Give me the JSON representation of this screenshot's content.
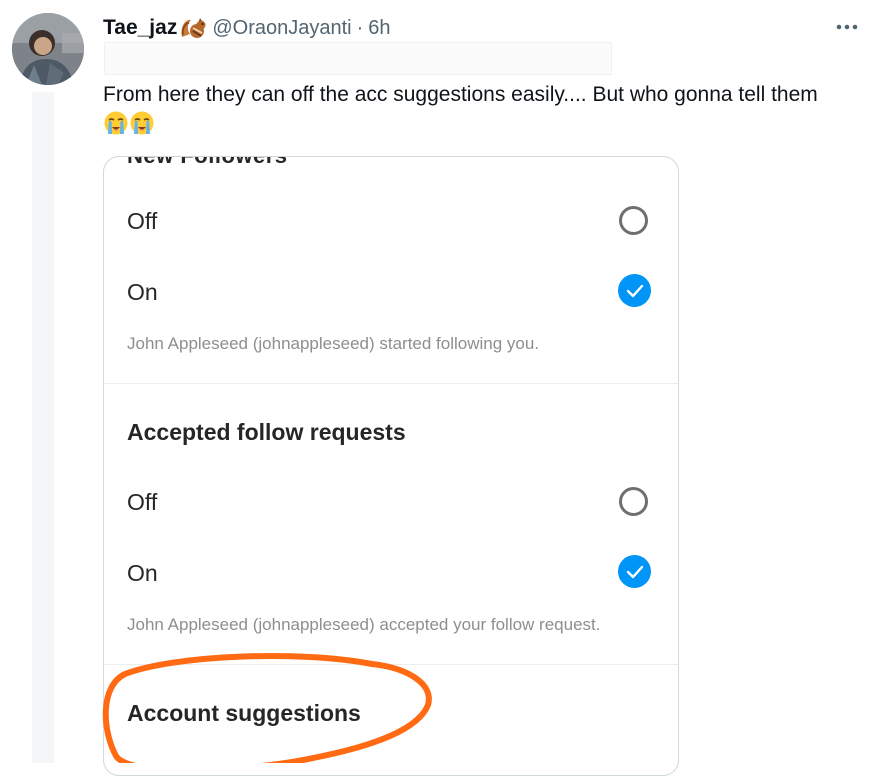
{
  "tweet": {
    "author": {
      "display_name": "Tae_jaz",
      "name_emoji": "chipmunk-emoji",
      "handle": "@OraonJayanti",
      "separator": "·",
      "time": "6h"
    },
    "more_icon": "more-horizontal-icon",
    "text": "From here they can off the acc suggestions easily.... But who gonna tell them",
    "text_emojis": [
      "loudly-crying-face-emoji",
      "loudly-crying-face-emoji"
    ]
  },
  "screenshot": {
    "cut_heading": "New Followers",
    "new_followers": {
      "options": [
        {
          "label": "Off",
          "selected": false
        },
        {
          "label": "On",
          "selected": true
        }
      ],
      "description": "John Appleseed (johnappleseed) started following you."
    },
    "accepted_follow_requests": {
      "heading": "Accepted follow requests",
      "options": [
        {
          "label": "Off",
          "selected": false
        },
        {
          "label": "On",
          "selected": true
        }
      ],
      "description": "John Appleseed (johnappleseed) accepted your follow request."
    },
    "account_suggestions": {
      "heading": "Account suggestions"
    },
    "highlight_color": "#ff6a13",
    "accent_color": "#0095f6"
  }
}
